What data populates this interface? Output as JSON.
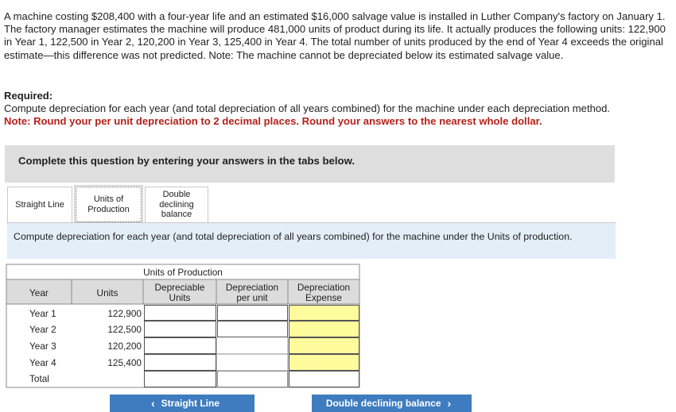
{
  "problem": {
    "text": "A machine costing $208,400 with a four-year life and an estimated $16,000 salvage value is installed in Luther Company's factory on January 1. The factory manager estimates the machine will produce 481,000 units of product during its life. It actually produces the following units: 122,900 in Year 1, 122,500 in Year 2, 120,200 in Year 3, 125,400 in Year 4. The total number of units produced by the end of Year 4 exceeds the original estimate—this difference was not predicted. Note: The machine cannot be depreciated below its estimated salvage value."
  },
  "required": {
    "heading": "Required:",
    "text": "Compute depreciation for each year (and total depreciation of all years combined) for the machine under each depreciation method.",
    "note": "Note: Round your per unit depreciation to 2 decimal places. Round your answers to the nearest whole dollar."
  },
  "banner": {
    "text": "Complete this question by entering your answers in the tabs below."
  },
  "tabs": {
    "straight_line": "Straight Line",
    "units_of_production": "Units of Production",
    "double_declining": "Double declining balance"
  },
  "instruction": {
    "text": "Compute depreciation for each year (and total depreciation of all years combined) for the machine under the Units of production."
  },
  "table": {
    "title": "Units of Production",
    "headers": {
      "year": "Year",
      "units": "Units",
      "depreciable_units": "Depreciable Units",
      "depreciation_per_unit": "Depreciation per unit",
      "depreciation_expense": "Depreciation Expense"
    },
    "rows": [
      {
        "year": "Year 1",
        "units": "122,900"
      },
      {
        "year": "Year 2",
        "units": "122,500"
      },
      {
        "year": "Year 3",
        "units": "120,200"
      },
      {
        "year": "Year 4",
        "units": "125,400"
      },
      {
        "year": "Total",
        "units": ""
      }
    ],
    "colors": {
      "header_bg": "#dcdcdc",
      "answer_bg": "#fdfb9c",
      "border": "#8a8a8a"
    }
  },
  "nav": {
    "prev_label": "Straight Line",
    "next_label": "Double declining balance",
    "color": "#3f7cbf"
  }
}
